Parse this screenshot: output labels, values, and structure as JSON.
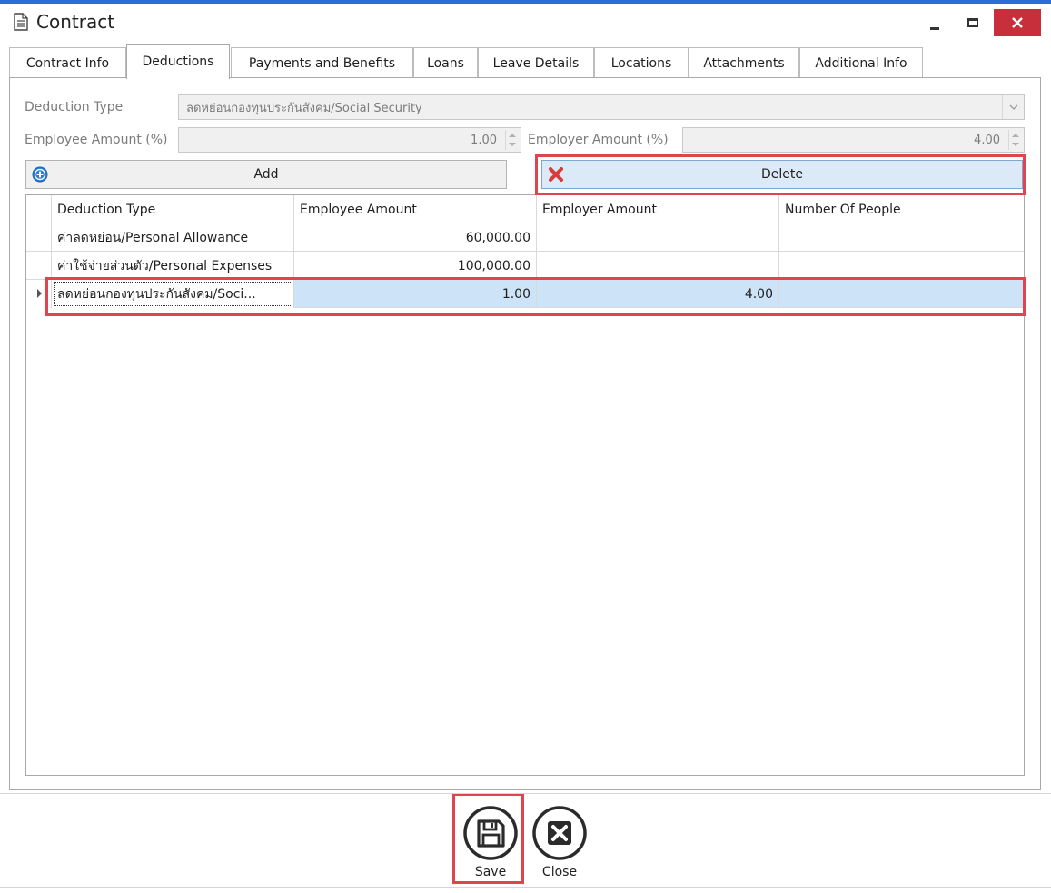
{
  "window": {
    "title": "Contract"
  },
  "tabs": [
    {
      "label": "Contract Info"
    },
    {
      "label": "Deductions"
    },
    {
      "label": "Payments and Benefits"
    },
    {
      "label": "Loans"
    },
    {
      "label": "Leave Details"
    },
    {
      "label": "Locations"
    },
    {
      "label": "Attachments"
    },
    {
      "label": "Additional Info"
    }
  ],
  "active_tab": "Deductions",
  "form": {
    "deduction_type_label": "Deduction Type",
    "deduction_type_value": "ลดหย่อนกองทุนประกันสังคม/Social Security",
    "employee_amount_label": "Employee Amount (%)",
    "employee_amount_value": "1.00",
    "employer_amount_label": "Employer Amount (%)",
    "employer_amount_value": "4.00"
  },
  "actions": {
    "add_label": "Add",
    "delete_label": "Delete"
  },
  "grid": {
    "columns": [
      "Deduction Type",
      "Employee Amount",
      "Employer Amount",
      "Number Of People"
    ],
    "rows": [
      {
        "deduction_type": "ค่าลดหย่อน/Personal Allowance",
        "employee_amount": "60,000.00",
        "employer_amount": "",
        "number_of_people": ""
      },
      {
        "deduction_type": "ค่าใช้จ่ายส่วนตัว/Personal Expenses",
        "employee_amount": "100,000.00",
        "employer_amount": "",
        "number_of_people": ""
      },
      {
        "deduction_type": "ลดหย่อนกองทุนประกันสังคม/Soci...",
        "employee_amount": "1.00",
        "employer_amount": "4.00",
        "number_of_people": ""
      }
    ],
    "selected_row": 2
  },
  "footer": {
    "save_label": "Save",
    "close_label": "Close"
  },
  "colors": {
    "highlight_red": "#e0454f",
    "selection_blue": "#cde3f7",
    "close_button_red": "#c7303b",
    "add_icon_blue": "#2f7fd6"
  }
}
